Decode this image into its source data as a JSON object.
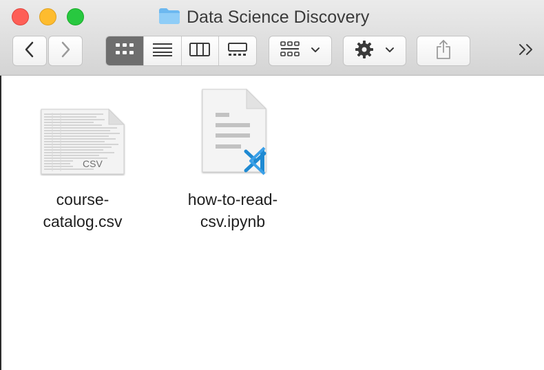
{
  "window": {
    "title": "Data Science Discovery"
  },
  "toolbar": {
    "back_icon": "chevron-left-icon",
    "forward_icon": "chevron-right-icon",
    "views": [
      {
        "icon": "icon-view-icon",
        "active": true
      },
      {
        "icon": "list-view-icon",
        "active": false
      },
      {
        "icon": "column-view-icon",
        "active": false
      },
      {
        "icon": "gallery-view-icon",
        "active": false
      }
    ],
    "group_icon": "group-by-icon",
    "action_icon": "gear-icon",
    "share_icon": "share-icon",
    "more_icon": "double-chevron-right-icon"
  },
  "files": [
    {
      "name_line1": "course-",
      "name_line2": "catalog.csv",
      "badge": "CSV",
      "icon": "csv-document-icon"
    },
    {
      "name_line1": "how-to-read-",
      "name_line2": "csv.ipynb",
      "icon": "vscode-document-icon"
    }
  ],
  "colors": {
    "close": "#fe5f57",
    "minimize": "#febc2e",
    "maximize": "#28c840",
    "folder": "#6cb8f0",
    "vscode": "#1f8ad2",
    "active_segment": "#6e6e6e"
  }
}
